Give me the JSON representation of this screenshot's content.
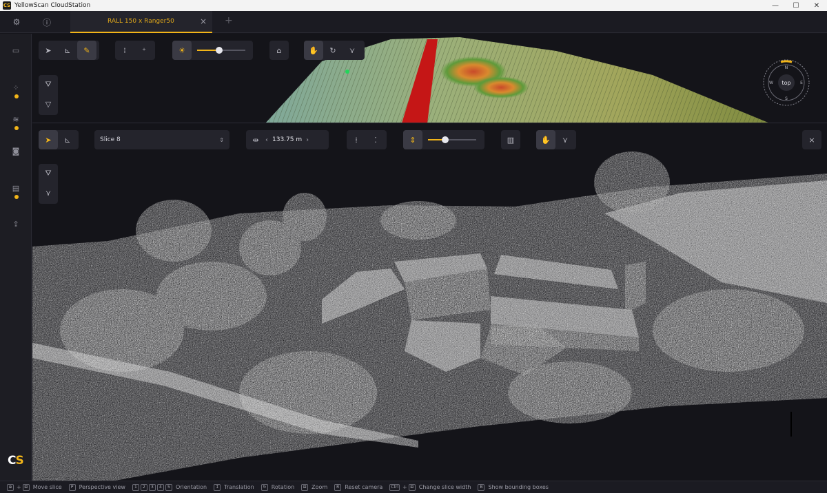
{
  "window": {
    "title": "YellowScan CloudStation",
    "logo": "CS",
    "min_icon": "minimize-icon",
    "max_icon": "maximize-icon",
    "close_icon": "close-icon"
  },
  "tabbar": {
    "settings_icon": "gear-icon",
    "info_icon": "info-icon",
    "active_tab": "RALL 150 x Ranger50",
    "tab_close": "×",
    "add": "+"
  },
  "sidebar": {
    "items": [
      {
        "icon": "folder-icon",
        "glyph": "▭",
        "badge": false
      },
      {
        "icon": "point-cloud-icon",
        "glyph": "⁘",
        "badge": true
      },
      {
        "icon": "layers-icon",
        "glyph": "≋",
        "badge": true
      },
      {
        "icon": "camera-icon",
        "glyph": "◙",
        "badge": false
      },
      {
        "icon": "report-icon",
        "glyph": "▤",
        "badge": true
      },
      {
        "icon": "export-icon",
        "glyph": "⇪",
        "badge": false
      }
    ],
    "brand": {
      "c": "C",
      "s": "S"
    }
  },
  "top_toolbar": {
    "nav_icon": "navigate-icon",
    "measure_icon": "measure-icon",
    "pick_icon": "picker-icon",
    "pointsize_icon": "point-size-icon",
    "pointsize2_icon": "point-size-plus-icon",
    "light_icon": "light-icon",
    "light_level": 0.45,
    "dome_icon": "dome-icon",
    "hand_icon": "pan-icon",
    "rotate_icon": "rotate-icon",
    "axis_icon": "axis-icon",
    "paint_icon": "paint-bucket-icon",
    "filter_icon": "filter-icon"
  },
  "compass": {
    "label": "top",
    "n": "N",
    "e": "E",
    "s": "S",
    "w": "W"
  },
  "main_toolbar": {
    "slice_value": "Slice 8",
    "width_value": "133.75 m",
    "left_arrow": "‹",
    "right_arrow": "›",
    "light_level": 0.35,
    "close": "×"
  },
  "statusbar": {
    "items": [
      {
        "keys": "⊕ + ⊞",
        "label": "Move slice"
      },
      {
        "keys": "P",
        "label": "Perspective view"
      },
      {
        "keys": "1 2 3 4 5",
        "label": "Orientation"
      },
      {
        "keys": "↕",
        "label": "Translation"
      },
      {
        "keys": "↻",
        "label": "Rotation"
      },
      {
        "keys": "⊞",
        "label": "Zoom"
      },
      {
        "keys": "R",
        "label": "Reset camera"
      },
      {
        "keys": "Ctrl + ⊞",
        "label": "Change slice width"
      },
      {
        "keys": "B",
        "label": "Show bounding boxes"
      }
    ]
  },
  "colors": {
    "accent": "#f2b519",
    "panel": "#24242c",
    "bg": "#141419"
  }
}
